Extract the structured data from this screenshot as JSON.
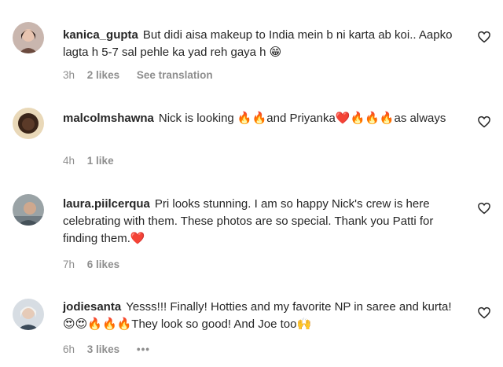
{
  "comments": [
    {
      "username": "kanica_gupta",
      "text": "But didi aisa makeup to India mein b ni karta ab koi.. Aapko lagta h 5-7 sal pehle ka yad reh gaya h 😁",
      "time": "3h",
      "likes": "2 likes",
      "translate": "See translation"
    },
    {
      "username": "malcolmshawna",
      "text": "Nick is looking 🔥🔥and Priyanka❤️🔥🔥🔥as always",
      "time": "4h",
      "likes": "1 like"
    },
    {
      "username": "laura.piilcerqua",
      "text": "Pri looks stunning. I am so happy Nick's crew is here celebrating with them. These photos are so special. Thank you Patti for finding them.❤️",
      "time": "7h",
      "likes": "6 likes"
    },
    {
      "username": "jodiesanta",
      "text": "Yesss!!! Finally! Hotties and my favorite NP in saree and kurta!😍😍🔥🔥🔥They look so good! And Joe too🙌",
      "time": "6h",
      "likes": "3 likes",
      "more": "•••"
    }
  ],
  "icons": {
    "like": "heart-outline-icon",
    "more": "more-horizontal-icon"
  }
}
